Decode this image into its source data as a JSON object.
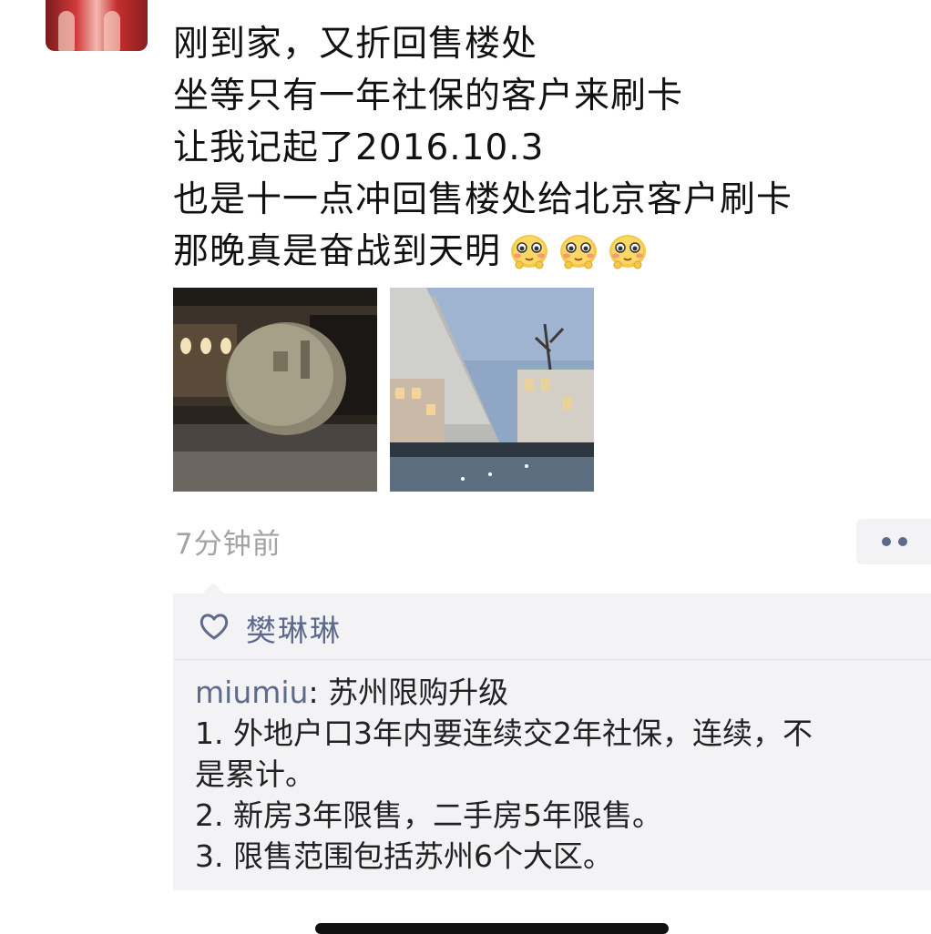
{
  "post": {
    "lines": [
      "刚到家，又折回售楼处",
      "坐等只有一年社保的客户来刷卡",
      "让我记起了2016.10.3",
      "也是十一点冲回售楼处给北京客户刷卡",
      "那晚真是奋战到天明"
    ],
    "emoji_icon": "blushing-face-emoji",
    "emoji_count": 3,
    "timestamp": "7分钟前"
  },
  "likes": {
    "icon": "heart-outline-icon",
    "names": "樊琳琳"
  },
  "comment": {
    "author": "miumiu",
    "separator": ": ",
    "first_line_text": "苏州限购升级",
    "lines": [
      "1. 外地户口3年内要连续交2年社保，连续，不",
      "是累计。",
      "2. 新房3年限售，二手房5年限售。",
      "3. 限售范围包括苏州6个大区。"
    ]
  },
  "colors": {
    "accent_name": "#5e6a8c",
    "timestamp": "#a3a3a3",
    "comment_bg": "#f3f3f5"
  }
}
